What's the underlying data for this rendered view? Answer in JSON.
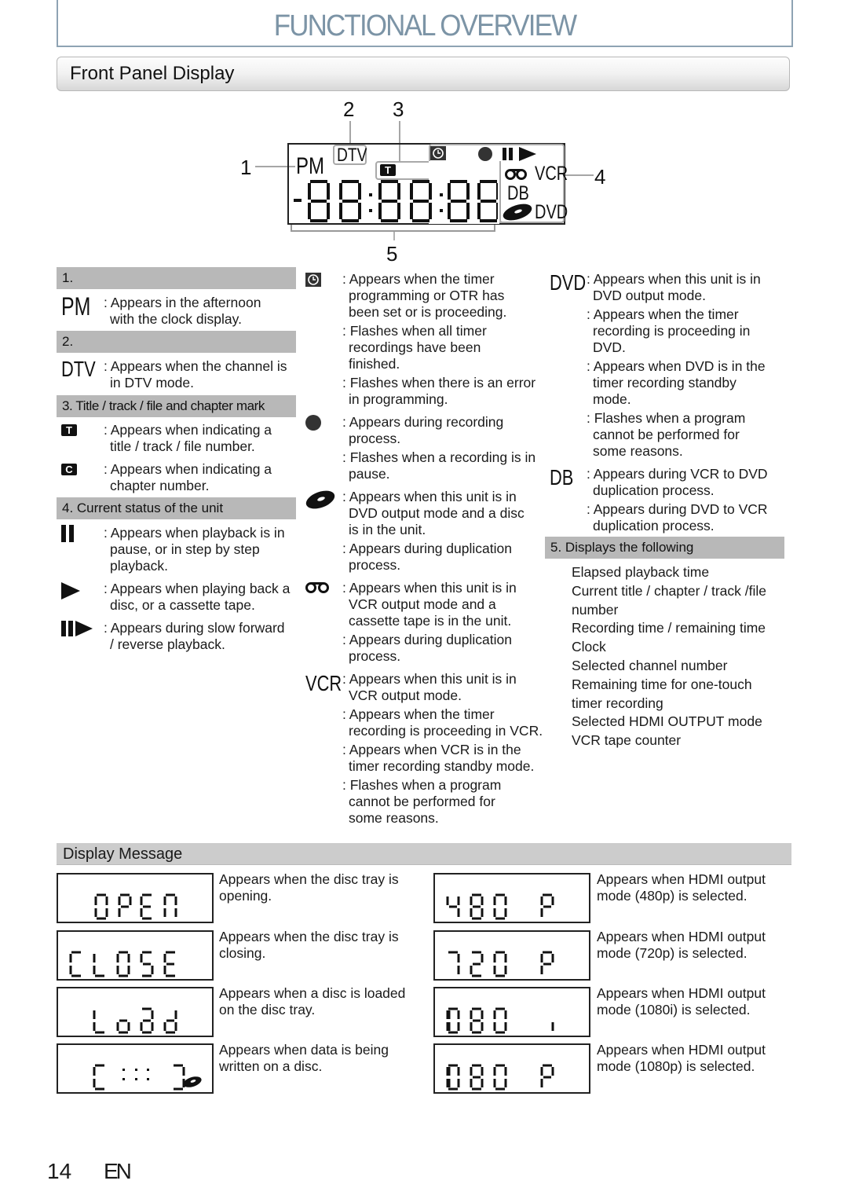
{
  "page": {
    "title": "FUNCTIONAL OVERVIEW",
    "section": "Front Panel Display",
    "page_number": "14",
    "language": "EN"
  },
  "diagram": {
    "callouts": [
      "1",
      "2",
      "3",
      "4",
      "5"
    ],
    "labels": {
      "pm": "PM",
      "dtv": "DTV",
      "vcr": "VCR",
      "db": "DB",
      "dvd": "DVD",
      "title_mark": "T",
      "chapter_mark": "C"
    },
    "digits": "-88:88:88"
  },
  "col1": {
    "h1": "1.",
    "pm_symbol": "PM",
    "pm_desc": [
      ": Appears in the afternoon",
      "with the clock display."
    ],
    "h2": "2.",
    "dtv_symbol": "DTV",
    "dtv_desc": [
      ": Appears when the channel is",
      "in DTV mode."
    ],
    "h3": "3. Title / track / file and chapter mark",
    "t_symbol": "T",
    "t_desc": [
      ": Appears when indicating a",
      "title / track / file number."
    ],
    "c_symbol": "C",
    "c_desc": [
      ": Appears when indicating a",
      "chapter number."
    ],
    "h4": "4. Current status of the unit",
    "pause_desc": [
      ": Appears when playback is in",
      "pause, or in step by step",
      "playback."
    ],
    "play_desc": [
      ": Appears when playing back a",
      "disc, or a cassette tape."
    ],
    "slow_desc": [
      ": Appears during slow forward",
      "/ reverse playback."
    ]
  },
  "col2": {
    "timer_desc": [
      ": Appears when the timer",
      "programming or OTR has",
      "been set or is proceeding.",
      ": Flashes when all timer",
      "recordings have been",
      "finished.",
      ": Flashes when there is an error",
      "in programming."
    ],
    "rec_desc": [
      ": Appears during recording",
      "process.",
      ": Flashes when a recording is in",
      "pause."
    ],
    "disc_desc": [
      ": Appears when this unit is in",
      "DVD output mode and a disc",
      "is in the unit.",
      ": Appears during duplication",
      "process."
    ],
    "tape_desc": [
      ": Appears when this unit is in",
      "VCR output mode and a",
      "cassette tape is in the unit.",
      ": Appears during duplication",
      "process."
    ],
    "vcr_symbol": "VCR",
    "vcr_desc": [
      ": Appears when this unit is in",
      "VCR output mode.",
      ": Appears when the timer",
      "recording is proceeding in VCR.",
      ": Appears when VCR is in the",
      "timer recording standby mode.",
      ": Flashes when a program",
      "cannot be performed for",
      "some reasons."
    ]
  },
  "col3": {
    "dvd_symbol": "DVD",
    "dvd_desc": [
      ": Appears when this unit is in",
      "DVD output mode.",
      ": Appears when the timer",
      "recording is proceeding in",
      "DVD.",
      ": Appears when DVD is in the",
      "timer recording standby",
      "mode.",
      ": Flashes when a program",
      "cannot be performed for",
      "some reasons."
    ],
    "db_symbol": "DB",
    "db_desc": [
      ": Appears during VCR to DVD",
      "duplication process.",
      ": Appears during DVD to VCR",
      "duplication process."
    ],
    "h5": "5. Displays the following",
    "list": [
      "Elapsed playback time",
      "Current title / chapter / track /file",
      "number",
      "Recording time / remaining time",
      "Clock",
      "Selected channel number",
      "Remaining time for one-touch",
      "timer recording",
      "Selected HDMI OUTPUT mode",
      "VCR tape counter"
    ]
  },
  "display_message": {
    "heading": "Display Message",
    "left": [
      {
        "lcd": "OPEN",
        "desc": [
          "Appears when the disc tray is",
          "opening."
        ]
      },
      {
        "lcd": "CLOSE",
        "desc": [
          "Appears when the disc tray is",
          "closing."
        ]
      },
      {
        "lcd": "Load",
        "desc": [
          "Appears when a disc is loaded",
          "on the disc tray."
        ]
      },
      {
        "lcd": "[:::]",
        "desc": [
          "Appears when data is being",
          "written on a disc."
        ]
      }
    ],
    "right": [
      {
        "lcd": "480 P",
        "desc": [
          "Appears when HDMI output",
          "mode (480p) is selected."
        ]
      },
      {
        "lcd": "720 P",
        "desc": [
          "Appears when HDMI output",
          "mode (720p) is selected."
        ]
      },
      {
        "lcd": "1080 i",
        "desc": [
          "Appears when HDMI output",
          "mode (1080i) is selected."
        ]
      },
      {
        "lcd": "1080 P",
        "desc": [
          "Appears when HDMI output",
          "mode (1080p) is selected."
        ]
      }
    ]
  },
  "colors": {
    "title": "#7c94a6",
    "header_grey": "#b8b8b8",
    "display_bar": "#cccccc"
  }
}
